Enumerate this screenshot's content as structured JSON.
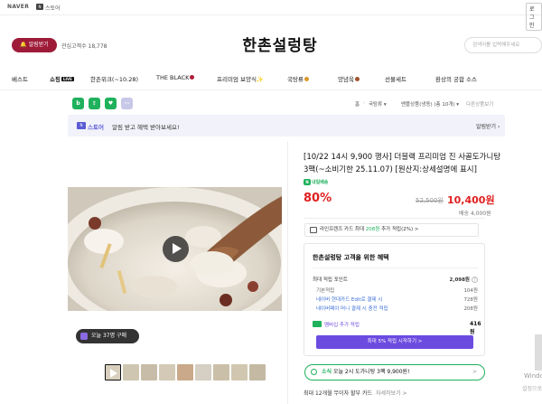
{
  "topbar": {
    "naver": "NAVER",
    "store_badge": "N",
    "store_label": "스토어",
    "login": "로그인"
  },
  "header": {
    "alarm_label": "알림받기",
    "interest": "관심고객수 18,778",
    "brand": "한촌설렁탕",
    "search_placeholder": "검색어를 입력해주세요"
  },
  "nav": {
    "items": [
      {
        "label": "베스트"
      },
      {
        "label": "쇼핑",
        "badge": "LIVE"
      },
      {
        "label": "한촌위크(~10.28)"
      },
      {
        "label": "THE BLACK"
      },
      {
        "label": "프리미엄 보양식✨"
      },
      {
        "label": "국탕류"
      },
      {
        "label": "양념육"
      },
      {
        "label": "선물세트"
      },
      {
        "label": "환상의 궁합 소스"
      }
    ]
  },
  "share": {
    "icons": [
      "b",
      "⇪",
      "♥",
      "⋯"
    ],
    "colors": [
      "#1fb15c",
      "#1fb15c",
      "#1fb15c",
      "#c7c7e8"
    ]
  },
  "breadcrumb": {
    "home": "홈",
    "category": "국탕류",
    "sub": "밴플상품(냉동) (총 10개)",
    "next": "다른상품보기"
  },
  "banner": {
    "np": "N",
    "store": "스토어",
    "message": "알림 받고 혜택 받아보세요!",
    "get": "알림받기"
  },
  "product": {
    "title": "[10/22 14시 9,900 행사] 더블랙 프리미엄 진 사골도가니탕 3팩(~소비기한 25.11.07) [원산지:상세설명에 표시]",
    "pay_badge": "내일배송",
    "discount": "80%",
    "orig_price": "52,500원",
    "sale_price": "10,400원",
    "shipping": "배송 4,000원",
    "buy_today": "오늘 37명 구매",
    "card_offer_prefix": "라인프렌즈 카드 최대 ",
    "card_offer_highlight": "208원",
    "card_offer_suffix": " 추가 적립(2%) >"
  },
  "benefit": {
    "title": "한촌설렁탕 고객을 위한 혜택",
    "rows": [
      {
        "label": "최대 적립 포인트",
        "value": "2,098원"
      },
      {
        "label": "기본적립",
        "value": "104원"
      },
      {
        "label": "네이버 현대카드 Edit로 결제 시",
        "value": "728원"
      },
      {
        "label": "네이버페이 머니 결제 시 충전 적립",
        "value": "208원"
      }
    ],
    "membership_label": "멤버십 추가 적립",
    "membership_value": "416원",
    "button": "최대 5% 적립 시작하기 >"
  },
  "notice": {
    "prefix": "소식",
    "text": " 오늘 2시 도가니탕 3팩 9,900원!",
    "arrow": ">"
  },
  "install": {
    "text": "최대 12개월 무이자 할부 카드",
    "more": "자세히보기 >"
  },
  "watermark": {
    "line1": "Windo",
    "line2": "설정으로"
  }
}
